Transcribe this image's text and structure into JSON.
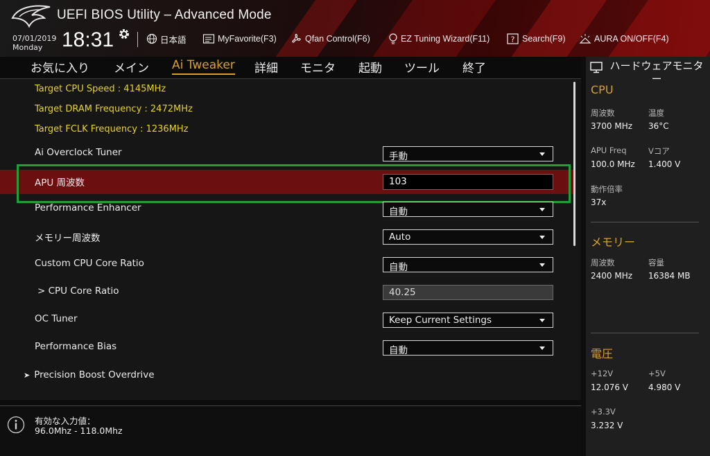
{
  "header": {
    "title": "UEFI BIOS Utility – Advanced Mode",
    "date": "07/01/2019",
    "day": "Monday",
    "time": "18:31",
    "buttons": [
      {
        "icon": "globe-icon",
        "label": "日本語"
      },
      {
        "icon": "favorite-list-icon",
        "label": "MyFavorite(F3)"
      },
      {
        "icon": "fan-icon",
        "label": "Qfan Control(F6)"
      },
      {
        "icon": "lightbulb-icon",
        "label": "EZ Tuning Wizard(F11)"
      },
      {
        "icon": "search-help-icon",
        "label": "Search(F9)"
      },
      {
        "icon": "aura-icon",
        "label": "AURA ON/OFF(F4)"
      }
    ]
  },
  "tabs": [
    "お気に入り",
    "メイン",
    "Ai Tweaker",
    "詳細",
    "モニタ",
    "起動",
    "ツール",
    "終了"
  ],
  "active_tab": "Ai Tweaker",
  "targets": [
    "Target CPU Speed : 4145MHz",
    "Target DRAM Frequency : 2472MHz",
    "Target FCLK Frequency : 1236MHz"
  ],
  "settings": [
    {
      "label": "Ai Overclock Tuner",
      "value": "手動"
    },
    {
      "label": "APU 周波数",
      "value": "103"
    },
    {
      "label": "Performance Enhancer",
      "value": "自動"
    },
    {
      "label": "メモリー周波数",
      "value": "Auto"
    },
    {
      "label": "Custom CPU Core Ratio",
      "value": "自動"
    },
    {
      "label": "> CPU Core Ratio",
      "value": "40.25"
    },
    {
      "label": "OC Tuner",
      "value": "Keep Current Settings"
    },
    {
      "label": "Performance Bias",
      "value": "自動"
    }
  ],
  "submenu": "Precision Boost Overdrive",
  "help": {
    "title": "有効な入力値：",
    "range": "96.0Mhz - 118.0Mhz"
  },
  "monitor": {
    "title": "ハードウェアモニター",
    "cpu": {
      "section": "CPU",
      "freq_label": "周波数",
      "freq_value": "3700 MHz",
      "temp_label": "温度",
      "temp_value": "36°C",
      "apu_label": "APU Freq",
      "apu_value": "100.0 MHz",
      "vcore_label": "Vコア",
      "vcore_value": "1.400 V",
      "ratio_label": "動作倍率",
      "ratio_value": "37x"
    },
    "memory": {
      "section": "メモリー",
      "freq_label": "周波数",
      "freq_value": "2400 MHz",
      "cap_label": "容量",
      "cap_value": "16384 MB"
    },
    "voltage": {
      "section": "電圧",
      "v12_label": "+12V",
      "v12_value": "12.076 V",
      "v5_label": "+5V",
      "v5_value": "4.980 V",
      "v33_label": "+3.3V",
      "v33_value": "3.232 V"
    }
  },
  "colors": {
    "accent": "#d7a12a",
    "target_text": "#e8d322",
    "selected_row": "#6b0f10",
    "highlight_box": "#21a038"
  }
}
